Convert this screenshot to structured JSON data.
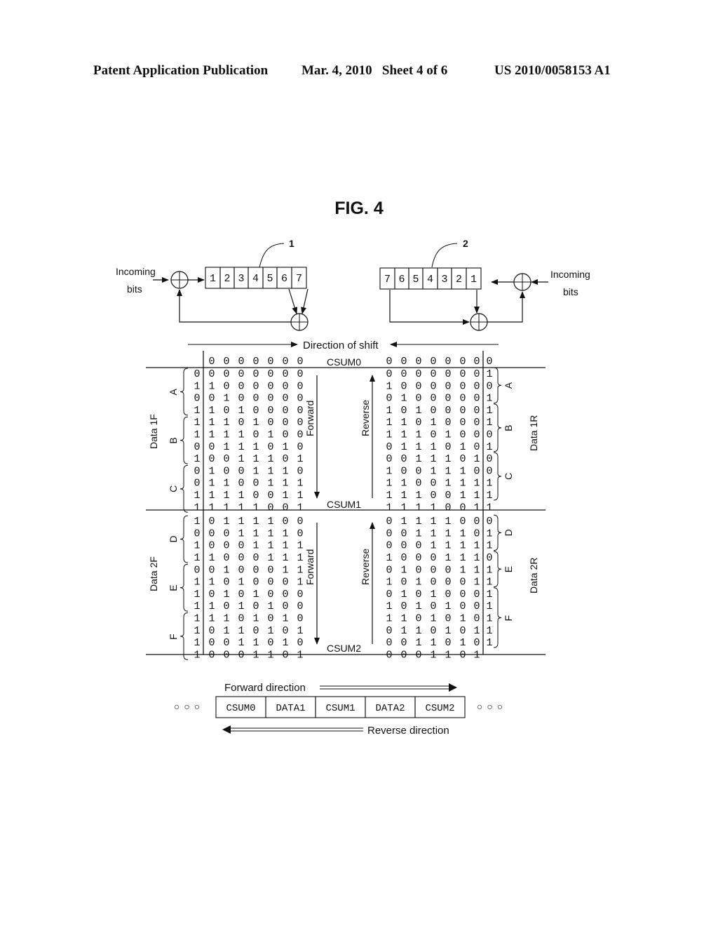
{
  "header": {
    "publication": "Patent Application Publication",
    "date_sheet": "Mar. 4, 2010   Sheet 4 of 6",
    "patent_number": "US 2010/0058153 A1"
  },
  "figure": {
    "title": "FIG. 4",
    "lfsr_forward": {
      "ref": "1",
      "input_label_line1": "Incoming",
      "input_label_line2": "bits",
      "cells": [
        "1",
        "2",
        "3",
        "4",
        "5",
        "6",
        "7"
      ]
    },
    "lfsr_reverse": {
      "ref": "2",
      "input_label_line1": "Incoming",
      "input_label_line2": "bits",
      "cells": [
        "7",
        "6",
        "5",
        "4",
        "3",
        "2",
        "1"
      ]
    },
    "direction_of_shift": "Direction of shift",
    "forward_label": "Forward",
    "reverse_label": "Reverse",
    "csum_labels": [
      "CSUM0",
      "CSUM1",
      "CSUM2"
    ],
    "group_labels": [
      "A",
      "B",
      "C",
      "D",
      "E",
      "F"
    ],
    "data_labels_left": [
      "Data 1F",
      "Data 2F"
    ],
    "data_labels_right": [
      "Data 1R",
      "Data 2R"
    ],
    "forward_table": {
      "header_row": "0000000",
      "rows": [
        {
          "in": "0",
          "reg": "0000000"
        },
        {
          "in": "1",
          "reg": "1000000"
        },
        {
          "in": "0",
          "reg": "0100000"
        },
        {
          "in": "1",
          "reg": "1010000"
        },
        {
          "in": "1",
          "reg": "1101000"
        },
        {
          "in": "1",
          "reg": "1110100"
        },
        {
          "in": "0",
          "reg": "0111010"
        },
        {
          "in": "1",
          "reg": "0011101"
        },
        {
          "in": "0",
          "reg": "1001110"
        },
        {
          "in": "0",
          "reg": "1100111"
        },
        {
          "in": "1",
          "reg": "1110011"
        },
        {
          "in": "1",
          "reg": "1111001"
        },
        {
          "in": "1",
          "reg": "0111100"
        },
        {
          "in": "0",
          "reg": "0011110"
        },
        {
          "in": "1",
          "reg": "0001111"
        },
        {
          "in": "1",
          "reg": "1000111"
        },
        {
          "in": "0",
          "reg": "0100011"
        },
        {
          "in": "1",
          "reg": "1010001"
        },
        {
          "in": "1",
          "reg": "0101000"
        },
        {
          "in": "1",
          "reg": "1010100"
        },
        {
          "in": "1",
          "reg": "1101010"
        },
        {
          "in": "1",
          "reg": "0110101"
        },
        {
          "in": "1",
          "reg": "0011010"
        },
        {
          "in": "1",
          "reg": "0001101"
        }
      ]
    },
    "reverse_table": {
      "rows": [
        {
          "reg": "0000000",
          "in": "0"
        },
        {
          "reg": "0000000",
          "in": "1"
        },
        {
          "reg": "1000000",
          "in": "0"
        },
        {
          "reg": "0100000",
          "in": "1"
        },
        {
          "reg": "1010000",
          "in": "1"
        },
        {
          "reg": "1101000",
          "in": "1"
        },
        {
          "reg": "1110100",
          "in": "0"
        },
        {
          "reg": "0111010",
          "in": "1"
        },
        {
          "reg": "0011101",
          "in": "0"
        },
        {
          "reg": "1001110",
          "in": "0"
        },
        {
          "reg": "1100111",
          "in": "1"
        },
        {
          "reg": "1110011",
          "in": "1"
        },
        {
          "reg": "1111001",
          "in": "1"
        },
        {
          "reg": "0111100",
          "in": "0"
        },
        {
          "reg": "0011110",
          "in": "1"
        },
        {
          "reg": "0001111",
          "in": "1"
        },
        {
          "reg": "1000111",
          "in": "0"
        },
        {
          "reg": "0100011",
          "in": "1"
        },
        {
          "reg": "1010001",
          "in": "1"
        },
        {
          "reg": "0101000",
          "in": "1"
        },
        {
          "reg": "1010100",
          "in": "1"
        },
        {
          "reg": "1101010",
          "in": "1"
        },
        {
          "reg": "0110101",
          "in": "1"
        },
        {
          "reg": "0011010",
          "in": "1"
        },
        {
          "reg": "0001101",
          "in": ""
        }
      ]
    },
    "stream": {
      "forward_direction": "Forward direction",
      "reverse_direction": "Reverse direction",
      "ellipsis": "○ ○ ○",
      "blocks": [
        "CSUM0",
        "DATA1",
        "CSUM1",
        "DATA2",
        "CSUM2"
      ]
    }
  }
}
